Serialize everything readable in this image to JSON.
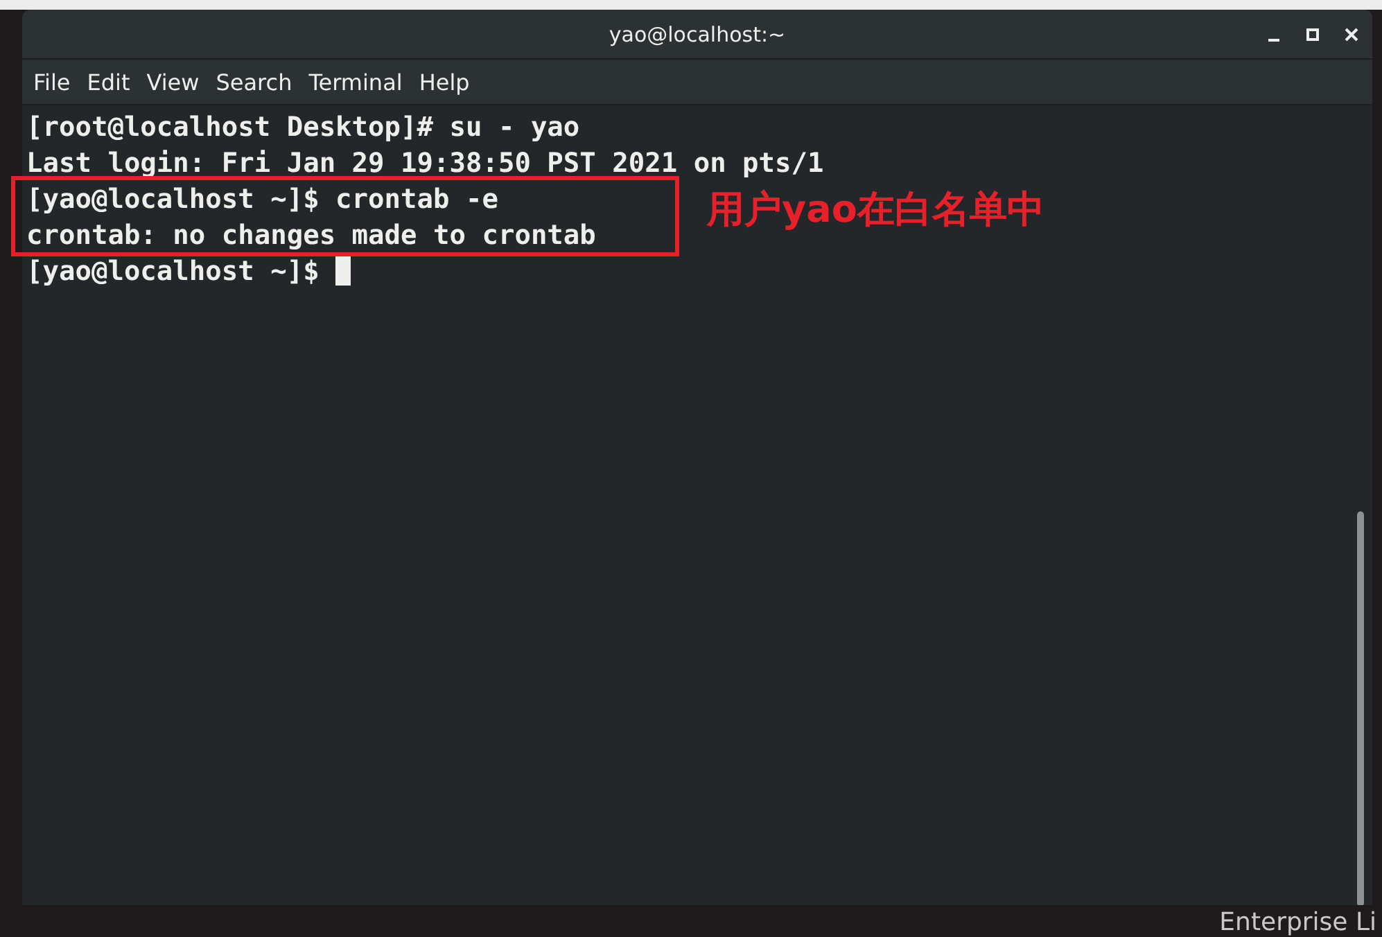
{
  "window": {
    "title": "yao@localhost:~"
  },
  "menu": [
    "File",
    "Edit",
    "View",
    "Search",
    "Terminal",
    "Help"
  ],
  "terminal": {
    "lines": [
      "[root@localhost Desktop]# su - yao",
      "Last login: Fri Jan 29 19:38:50 PST 2021 on pts/1",
      "[yao@localhost ~]$ crontab -e",
      "crontab: no changes made to crontab",
      "[yao@localhost ~]$ "
    ],
    "cursor_visible": true
  },
  "annotation": {
    "text": "用户yao在白名单中"
  },
  "desktop": {
    "text": "Enterprise Li"
  }
}
